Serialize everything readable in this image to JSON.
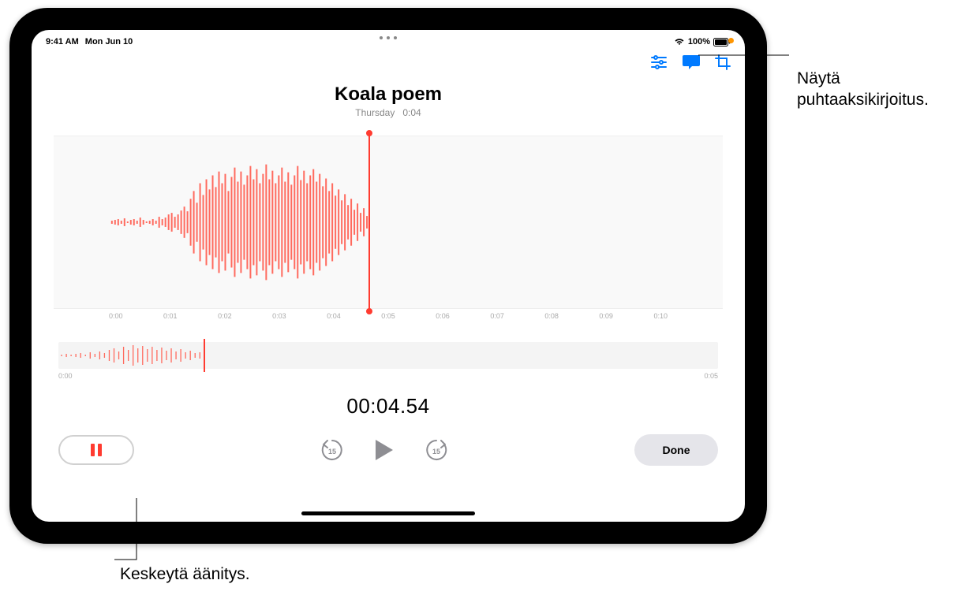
{
  "status": {
    "time": "9:41 AM",
    "date": "Mon Jun 10",
    "battery_label": "100%"
  },
  "recording": {
    "title": "Koala poem",
    "subtitle_day": "Thursday",
    "subtitle_len": "0:04",
    "elapsed": "00:04.54"
  },
  "ruler": [
    "0:00",
    "0:01",
    "0:02",
    "0:03",
    "0:04",
    "0:05",
    "0:06",
    "0:07",
    "0:08",
    "0:09",
    "0:10"
  ],
  "mini": {
    "start": "0:00",
    "end": "0:05"
  },
  "controls": {
    "done_label": "Done",
    "skip_back_label": "15",
    "skip_fwd_label": "15"
  },
  "callouts": {
    "transcript": "Näytä\npuhtaaksikirjoitus.",
    "pause": "Keskeytä äänitys."
  }
}
